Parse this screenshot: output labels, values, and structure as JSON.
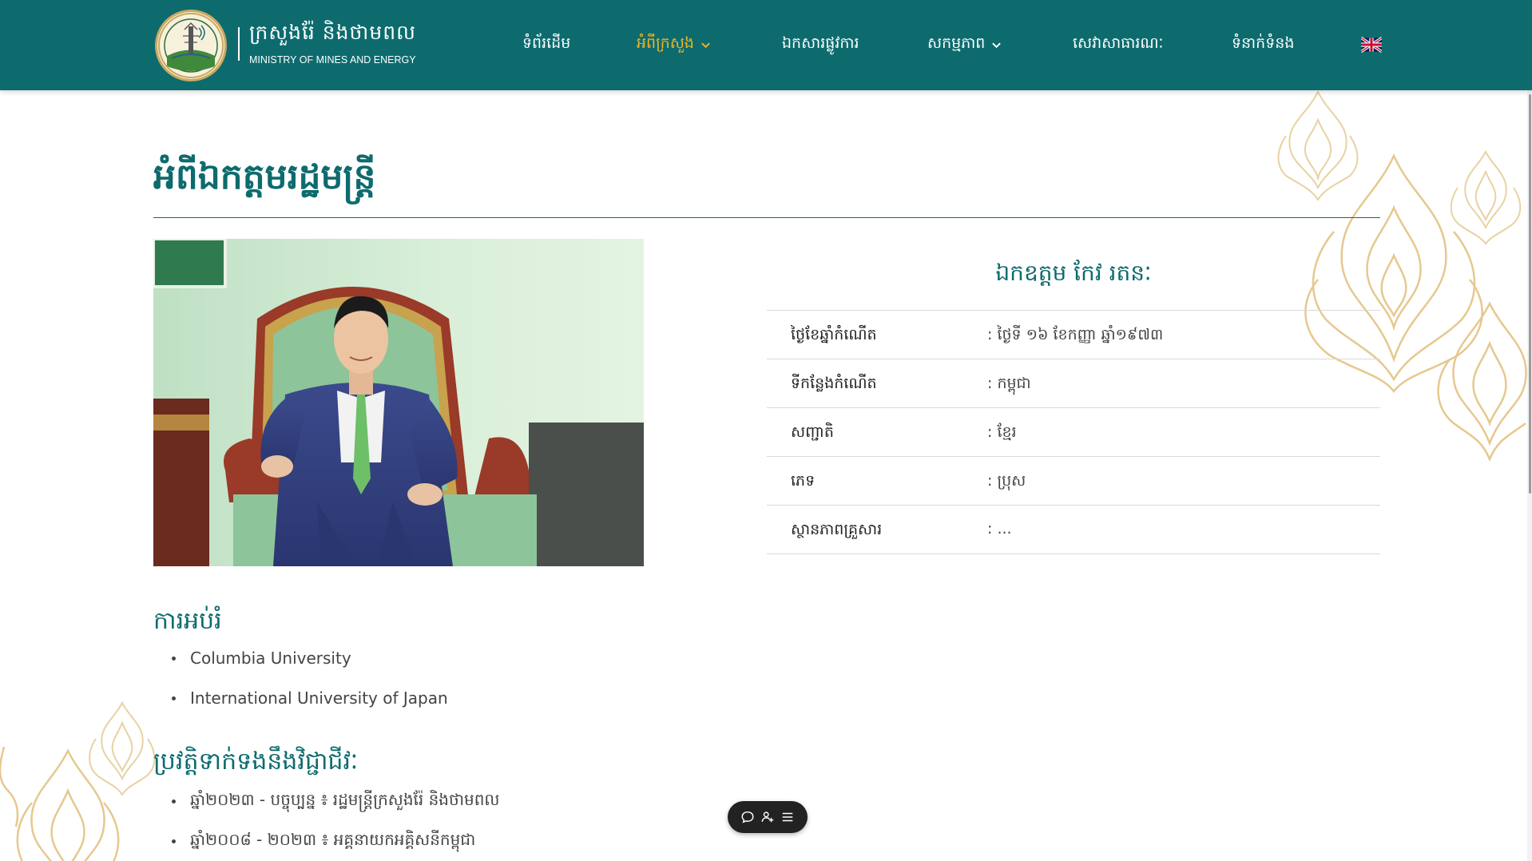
{
  "header": {
    "logo_khmer": "ក្រសួងរ៉ែ និងថាមពល",
    "logo_english": "MINISTRY OF MINES AND ENERGY",
    "nav": [
      {
        "label": "ទំព័រដើម",
        "has_dropdown": false,
        "active": false
      },
      {
        "label": "អំពីក្រសួង",
        "has_dropdown": true,
        "active": true
      },
      {
        "label": "ឯកសារផ្លូវការ",
        "has_dropdown": false,
        "active": false
      },
      {
        "label": "សកម្មភាព",
        "has_dropdown": true,
        "active": false
      },
      {
        "label": "សេវាសាធារណៈ",
        "has_dropdown": false,
        "active": false
      },
      {
        "label": "ទំនាក់ទំនង",
        "has_dropdown": false,
        "active": false
      }
    ],
    "language_icon": "uk-flag-icon"
  },
  "page": {
    "title": "អំពីឯកត្តមរដ្ឋមន្ត្រី"
  },
  "profile": {
    "name": "ឯកឧត្តម កែវ រតនៈ",
    "rows": [
      {
        "label": "ថ្ងៃខែឆ្នាំកំណើត",
        "value": ": ថ្ងៃទី ១៦ ខែកញ្ញា ឆ្នាំ១៩៧៣"
      },
      {
        "label": "ទីកន្លែងកំណើត",
        "value": ": កម្ពុជា"
      },
      {
        "label": "សញ្ជាតិ",
        "value": ": ខ្មែរ"
      },
      {
        "label": "ភេទ",
        "value": ": ប្រុស"
      },
      {
        "label": "ស្ថានភាពគ្រួសារ",
        "value": ": ..."
      }
    ]
  },
  "education": {
    "title": "ការអប់រំ",
    "items": [
      "Columbia University",
      "International University of Japan"
    ]
  },
  "career": {
    "title": "ប្រវត្តិទាក់ទងនឹងវិជ្ជាជីវៈ",
    "items": [
      "ឆ្នាំ២០២៣ - បច្ចុប្បន្ន ៖ រដ្ឋមន្ត្រីក្រសួងរ៉ែ និងថាមពល",
      "ឆ្នាំ២០០៨ - ២០២៣ ៖ អគ្គនាយកអគ្គិសនីកម្ពុជា"
    ]
  },
  "colors": {
    "brand_teal": "#0d6b6e",
    "active_nav": "#f0b429",
    "ornament_gold": "#e2c68d"
  }
}
